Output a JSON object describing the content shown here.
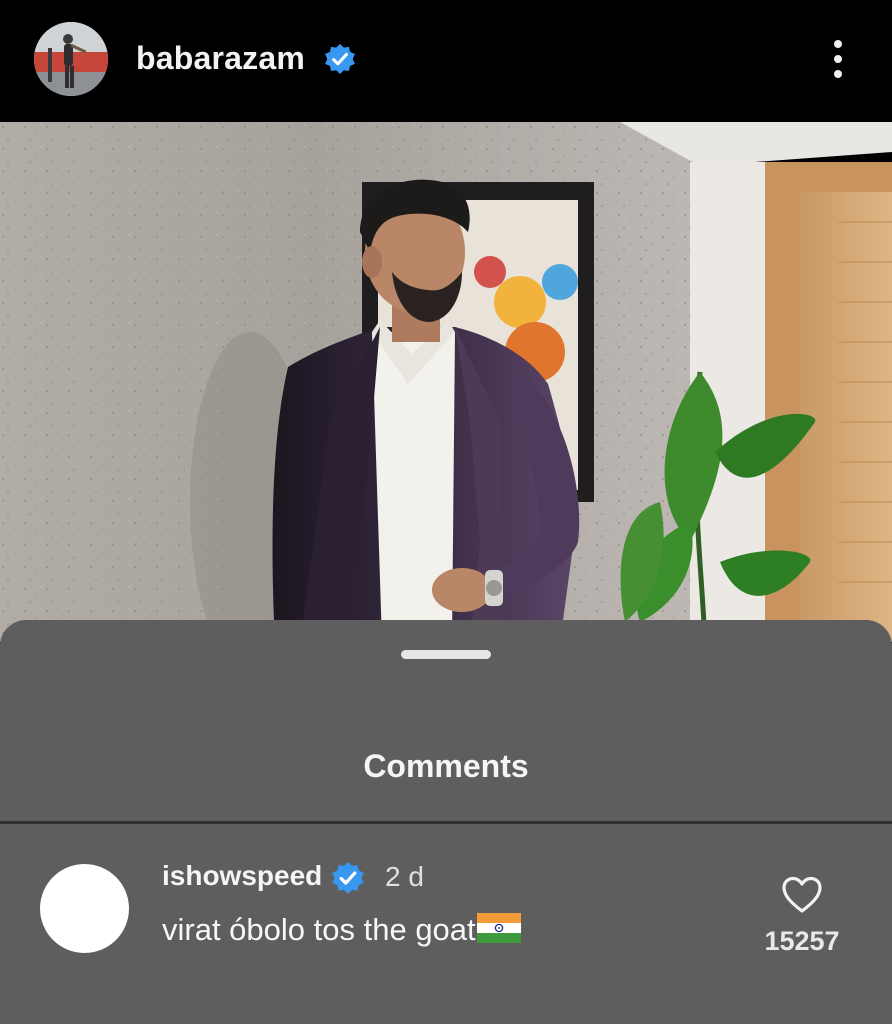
{
  "post": {
    "username": "babarazam",
    "avatar_icon": "profile-photo",
    "verified_icon": "verified-badge-icon",
    "more_icon": "more-vertical-icon",
    "photo_alt": "man in purple suit leaning against textured wall"
  },
  "comments_sheet": {
    "title": "Comments",
    "comments": [
      {
        "username": "ishowspeed",
        "verified_icon": "verified-badge-icon",
        "time": "2 d",
        "text": "virat óbolo tos the goat",
        "emoji_icon": "india-flag-icon",
        "like_icon": "heart-icon",
        "likes": "15257"
      }
    ]
  },
  "colors": {
    "header_bg": "#000000",
    "sheet_bg": "#5e5e5e",
    "verified_blue": "#3897f0",
    "text": "#f5f5f5"
  }
}
